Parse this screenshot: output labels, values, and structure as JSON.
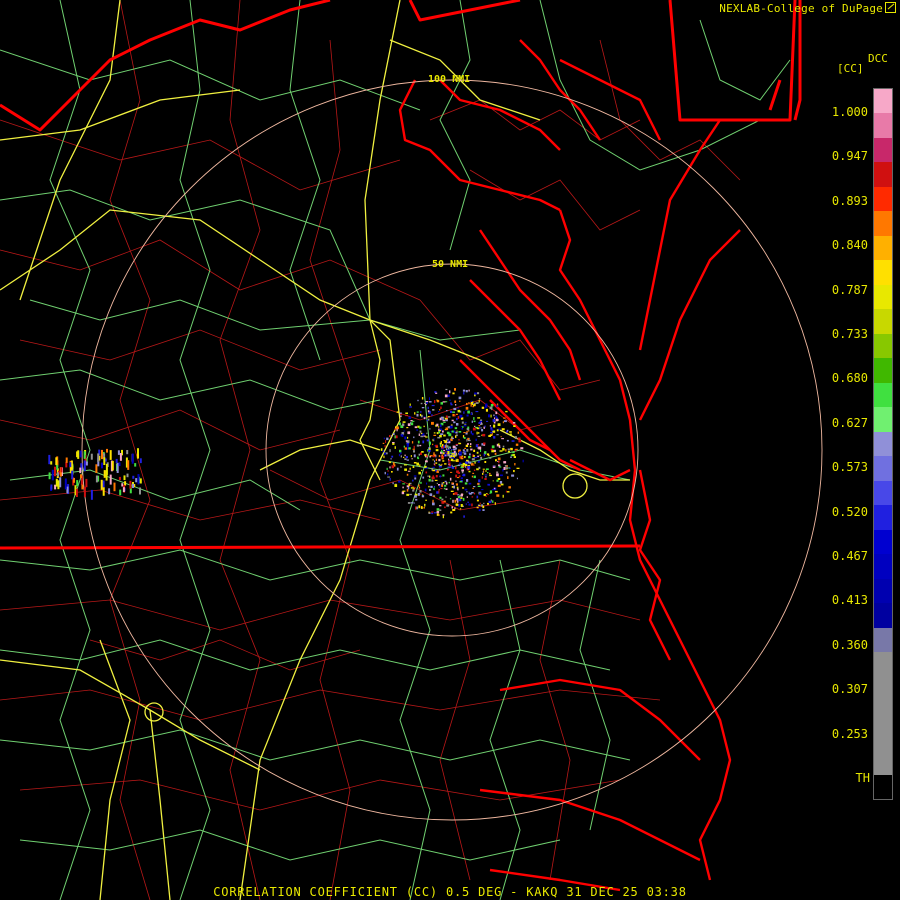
{
  "credit": "NEXLAB-College of DuPage",
  "credit_icon": "external-link-icon",
  "legend": {
    "product": "DCC",
    "units": "[CC]",
    "ticks": [
      "1.000",
      "0.947",
      "0.893",
      "0.840",
      "0.787",
      "0.733",
      "0.680",
      "0.627",
      "0.573",
      "0.520",
      "0.467",
      "0.413",
      "0.360",
      "0.307",
      "0.253",
      "TH"
    ],
    "colors": [
      "#f7a8c8",
      "#e87aa8",
      "#c8286a",
      "#d01010",
      "#ff2a00",
      "#ff7800",
      "#ffb000",
      "#ffe000",
      "#e8e800",
      "#c8d800",
      "#88c800",
      "#40b800",
      "#40e040",
      "#70f070",
      "#9090d8",
      "#7070e0",
      "#4848e8",
      "#2020e0",
      "#0000d0",
      "#0000c0",
      "#0000b0",
      "#0000a0",
      "#7878a8",
      "#909090",
      "#909090",
      "#909090",
      "#909090",
      "#909090",
      "#000000"
    ]
  },
  "rings": [
    "100 NMI",
    "50 NMI"
  ],
  "title": "CORRELATION COEFFICIENT (CC) 0.5 DEG - KAKQ 31 DEC 25 03:38",
  "colors": {
    "state_border": "#ff0000",
    "county_lines": "#c81818",
    "highways_major": "#f0f040",
    "highways_minor": "#70d070",
    "range_ring": "#f0b8a0",
    "text": "#e8e800"
  }
}
